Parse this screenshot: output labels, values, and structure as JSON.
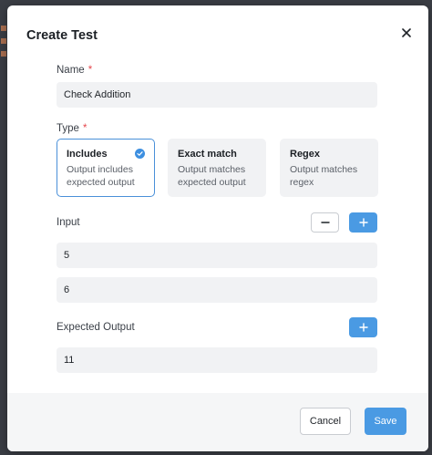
{
  "dialog": {
    "title": "Create Test",
    "close_icon": "close-icon"
  },
  "name_field": {
    "label": "Name",
    "required_mark": "*",
    "value": "Check Addition"
  },
  "type_field": {
    "label": "Type",
    "required_mark": "*",
    "options": [
      {
        "title": "Includes",
        "description": "Output includes expected output",
        "selected": true
      },
      {
        "title": "Exact match",
        "description": "Output matches expected output",
        "selected": false
      },
      {
        "title": "Regex",
        "description": "Output matches regex",
        "selected": false
      }
    ]
  },
  "input_field": {
    "label": "Input",
    "remove_icon": "minus-icon",
    "add_icon": "plus-icon",
    "values": [
      "5",
      "6"
    ]
  },
  "expected_output_field": {
    "label": "Expected Output",
    "add_icon": "plus-icon",
    "value": "11"
  },
  "footer": {
    "cancel_label": "Cancel",
    "save_label": "Save"
  },
  "colors": {
    "accent": "#4a9ae3",
    "required": "#e5484d",
    "selected_border": "#4a90d9"
  }
}
